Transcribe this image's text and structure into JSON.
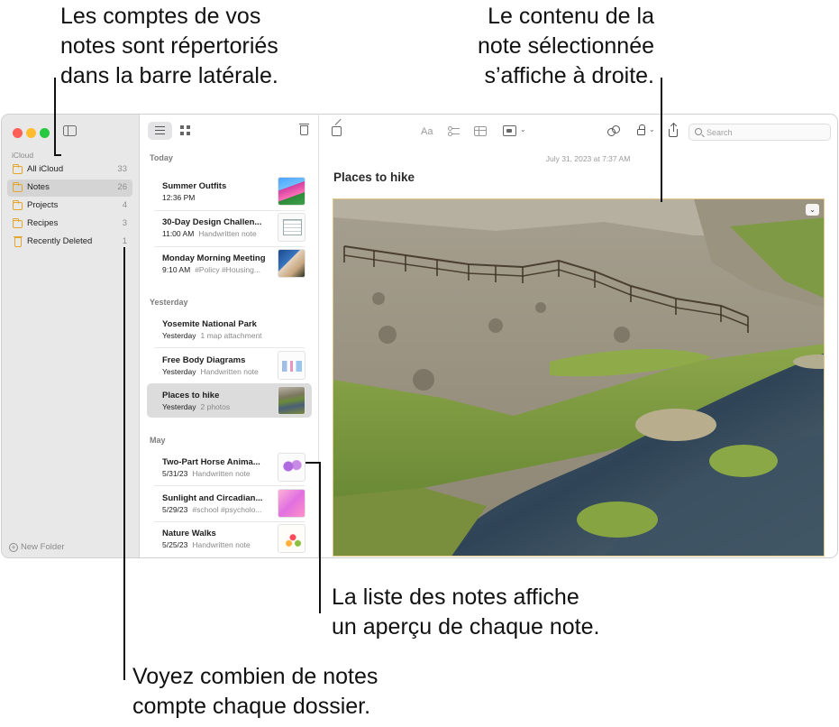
{
  "callouts": {
    "top_left": [
      "Les comptes de vos",
      "notes sont répertoriés",
      "dans la barre latérale."
    ],
    "top_right": [
      "Le contenu de la",
      "note sélectionnée",
      "s’affiche à droite."
    ],
    "middle_right": [
      "La liste des notes affiche",
      "un aperçu de chaque note."
    ],
    "bottom": [
      "Voyez combien de notes",
      "compte chaque dossier."
    ]
  },
  "sidebar": {
    "section": "iCloud",
    "folders": [
      {
        "label": "All iCloud",
        "count": "33",
        "icon": "folder-icon"
      },
      {
        "label": "Notes",
        "count": "26",
        "icon": "folder-icon",
        "selected": true
      },
      {
        "label": "Projects",
        "count": "4",
        "icon": "folder-icon"
      },
      {
        "label": "Recipes",
        "count": "3",
        "icon": "folder-icon"
      },
      {
        "label": "Recently Deleted",
        "count": "1",
        "icon": "trash-icon"
      }
    ],
    "new_folder": "New Folder"
  },
  "notelist": {
    "groups": {
      "today": "Today",
      "yesterday": "Yesterday",
      "may": "May"
    },
    "notes": [
      {
        "title": "Summer Outfits",
        "date": "12:36 PM",
        "snippet": ""
      },
      {
        "title": "30-Day Design Challen...",
        "date": "11:00 AM",
        "snippet": "Handwritten note"
      },
      {
        "title": "Monday Morning Meeting",
        "date": "9:10 AM",
        "snippet": "#Policy #Housing..."
      },
      {
        "title": "Yosemite National Park",
        "date": "Yesterday",
        "snippet": "1 map attachment"
      },
      {
        "title": "Free Body Diagrams",
        "date": "Yesterday",
        "snippet": "Handwritten note"
      },
      {
        "title": "Places to hike",
        "date": "Yesterday",
        "snippet": "2 photos",
        "selected": true
      },
      {
        "title": "Two-Part Horse Anima...",
        "date": "5/31/23",
        "snippet": "Handwritten note"
      },
      {
        "title": "Sunlight and Circadian...",
        "date": "5/29/23",
        "snippet": "#school #psycholo..."
      },
      {
        "title": "Nature Walks",
        "date": "5/25/23",
        "snippet": "Handwritten note"
      }
    ]
  },
  "editor": {
    "date": "July 31, 2023 at 7:37 AM",
    "title": "Places to hike",
    "format_label": "Aa",
    "search_placeholder": "Search",
    "chevron": "⌄"
  },
  "colors": {
    "accent_folder": "#e3a72f",
    "sidebar_bg": "#e9e8e9",
    "selected_note_bg": "#dcdcdc"
  }
}
